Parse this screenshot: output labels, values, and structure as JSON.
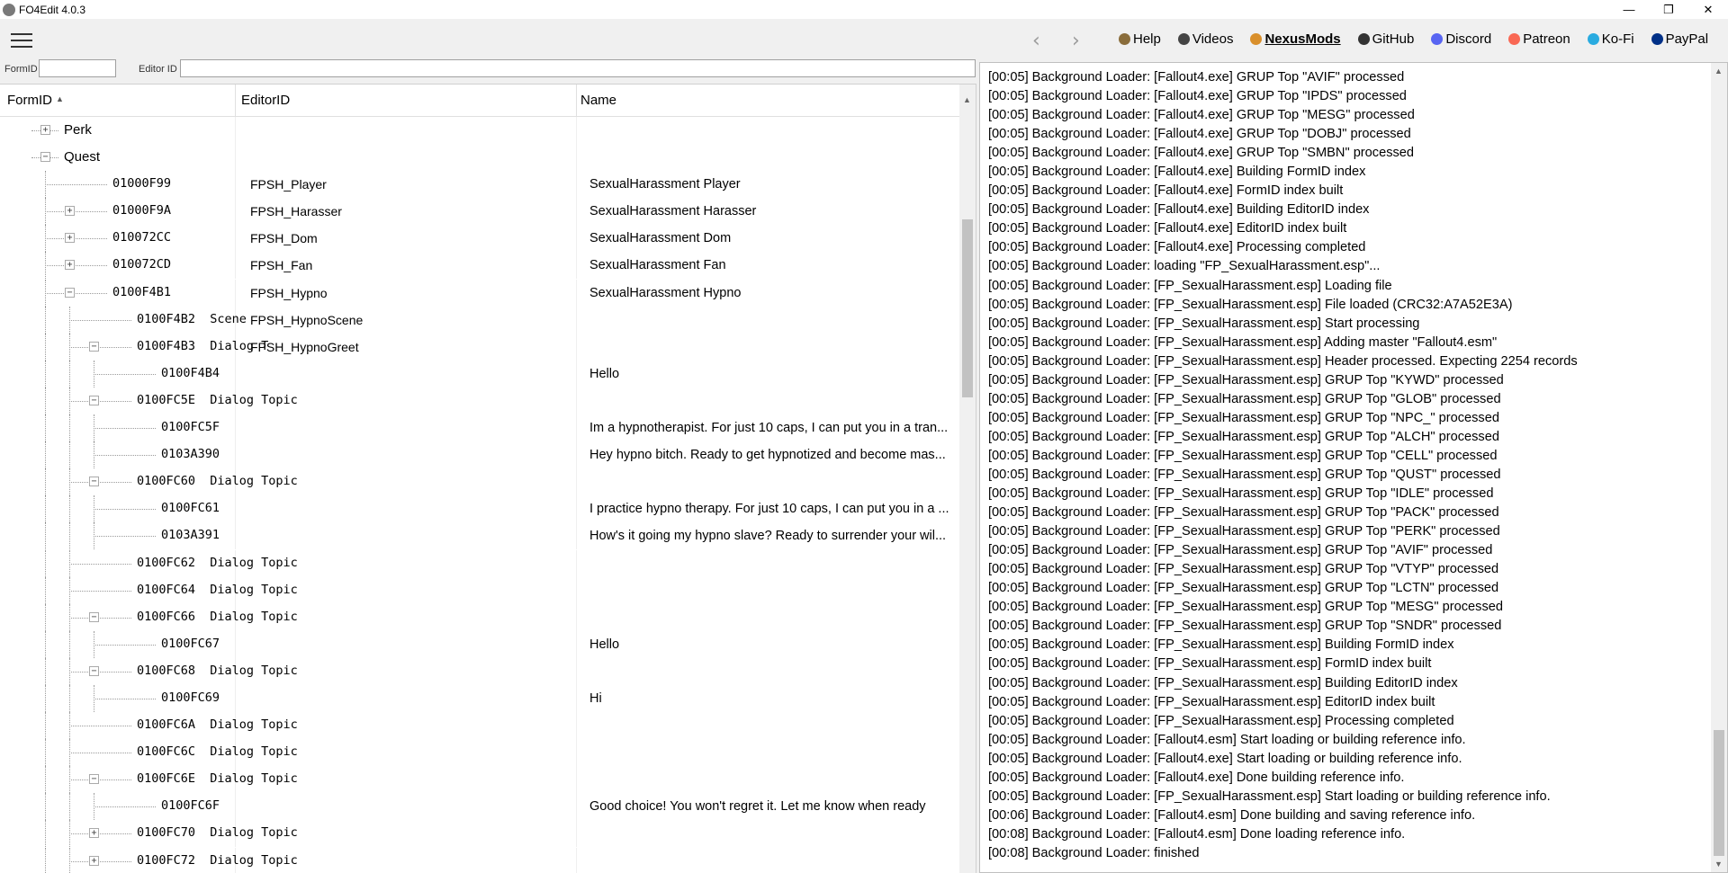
{
  "window": {
    "title": "FO4Edit 4.0.3",
    "controls": {
      "minimize": "—",
      "maximize": "❐",
      "close": "✕"
    }
  },
  "toolbar": {
    "back_icon": "chevron-left-icon",
    "forward_icon": "chevron-right-icon",
    "links": [
      {
        "label": "Help",
        "icon": "book-icon",
        "color": "#8a6d3b",
        "bold": false
      },
      {
        "label": "Videos",
        "icon": "video-icon",
        "color": "#444444",
        "bold": false
      },
      {
        "label": "NexusMods",
        "icon": "nexus-icon",
        "color": "#d98f2b",
        "bold": true
      },
      {
        "label": "GitHub",
        "icon": "github-icon",
        "color": "#333333",
        "bold": false
      },
      {
        "label": "Discord",
        "icon": "discord-icon",
        "color": "#5865f2",
        "bold": false
      },
      {
        "label": "Patreon",
        "icon": "patreon-icon",
        "color": "#f96854",
        "bold": false
      },
      {
        "label": "Ko-Fi",
        "icon": "kofi-icon",
        "color": "#29abe0",
        "bold": false
      },
      {
        "label": "PayPal",
        "icon": "paypal-icon",
        "color": "#003087",
        "bold": false
      }
    ]
  },
  "filter": {
    "formid_label": "FormID",
    "formid_value": "",
    "editorid_label": "Editor ID",
    "editorid_value": ""
  },
  "tree": {
    "columns": {
      "formid": "FormID",
      "editorid": "EditorID",
      "name": "Name"
    },
    "rows": [
      {
        "level": 1,
        "expander": "+",
        "text": "Perk",
        "is_group": true,
        "editorid": "",
        "name": ""
      },
      {
        "level": 1,
        "expander": "-",
        "text": "Quest",
        "is_group": true,
        "editorid": "",
        "name": ""
      },
      {
        "level": 2,
        "expander": "",
        "text": "01000F99",
        "editorid": "FPSH_Player",
        "name": "SexualHarassment Player"
      },
      {
        "level": 2,
        "expander": "+",
        "text": "01000F9A",
        "editorid": "FPSH_Harasser",
        "name": "SexualHarassment Harasser"
      },
      {
        "level": 2,
        "expander": "+",
        "text": "010072CC",
        "editorid": "FPSH_Dom",
        "name": "SexualHarassment Dom"
      },
      {
        "level": 2,
        "expander": "+",
        "text": "010072CD",
        "editorid": "FPSH_Fan",
        "name": "SexualHarassment Fan"
      },
      {
        "level": 2,
        "expander": "-",
        "text": "0100F4B1",
        "editorid": "FPSH_Hypno",
        "name": "SexualHarassment Hypno"
      },
      {
        "level": 3,
        "expander": "",
        "text": "0100F4B2  Scene",
        "editorid": "FPSH_HypnoScene",
        "name": ""
      },
      {
        "level": 3,
        "expander": "-",
        "text": "0100F4B3  Dialog T",
        "editorid": "FPSH_HypnoGreet",
        "name": ""
      },
      {
        "level": 4,
        "expander": "",
        "text": "0100F4B4",
        "editorid": "",
        "name": "Hello"
      },
      {
        "level": 3,
        "expander": "-",
        "text": "0100FC5E  Dialog Topic",
        "editorid": "",
        "name": ""
      },
      {
        "level": 4,
        "expander": "",
        "text": "0100FC5F",
        "editorid": "",
        "name": "Im a hypnotherapist. For just 10 caps, I can put you in a tran..."
      },
      {
        "level": 4,
        "expander": "",
        "text": "0103A390",
        "editorid": "",
        "name": "Hey hypno bitch. Ready to get hypnotized and become mas..."
      },
      {
        "level": 3,
        "expander": "-",
        "text": "0100FC60  Dialog Topic",
        "editorid": "",
        "name": ""
      },
      {
        "level": 4,
        "expander": "",
        "text": "0100FC61",
        "editorid": "",
        "name": "I practice hypno therapy. For just 10 caps, I can put you in a ..."
      },
      {
        "level": 4,
        "expander": "",
        "text": "0103A391",
        "editorid": "",
        "name": "How's it going my hypno slave? Ready to surrender your wil..."
      },
      {
        "level": 3,
        "expander": "",
        "text": "0100FC62  Dialog Topic",
        "editorid": "",
        "name": ""
      },
      {
        "level": 3,
        "expander": "",
        "text": "0100FC64  Dialog Topic",
        "editorid": "",
        "name": ""
      },
      {
        "level": 3,
        "expander": "-",
        "text": "0100FC66  Dialog Topic",
        "editorid": "",
        "name": ""
      },
      {
        "level": 4,
        "expander": "",
        "text": "0100FC67",
        "editorid": "",
        "name": "Hello"
      },
      {
        "level": 3,
        "expander": "-",
        "text": "0100FC68  Dialog Topic",
        "editorid": "",
        "name": ""
      },
      {
        "level": 4,
        "expander": "",
        "text": "0100FC69",
        "editorid": "",
        "name": "Hi"
      },
      {
        "level": 3,
        "expander": "",
        "text": "0100FC6A  Dialog Topic",
        "editorid": "",
        "name": ""
      },
      {
        "level": 3,
        "expander": "",
        "text": "0100FC6C  Dialog Topic",
        "editorid": "",
        "name": ""
      },
      {
        "level": 3,
        "expander": "-",
        "text": "0100FC6E  Dialog Topic",
        "editorid": "",
        "name": ""
      },
      {
        "level": 4,
        "expander": "",
        "text": "0100FC6F",
        "editorid": "",
        "name": "Good choice! You won't regret it. Let me know when ready"
      },
      {
        "level": 3,
        "expander": "+",
        "text": "0100FC70  Dialog Topic",
        "editorid": "",
        "name": ""
      },
      {
        "level": 3,
        "expander": "+",
        "text": "0100FC72  Dialog Topic",
        "editorid": "",
        "name": ""
      }
    ]
  },
  "log": {
    "lines": [
      "[00:05] Background Loader: [Fallout4.exe] GRUP Top \"AVIF\" processed",
      "[00:05] Background Loader: [Fallout4.exe] GRUP Top \"IPDS\" processed",
      "[00:05] Background Loader: [Fallout4.exe] GRUP Top \"MESG\" processed",
      "[00:05] Background Loader: [Fallout4.exe] GRUP Top \"DOBJ\" processed",
      "[00:05] Background Loader: [Fallout4.exe] GRUP Top \"SMBN\" processed",
      "[00:05] Background Loader: [Fallout4.exe] Building FormID index",
      "[00:05] Background Loader: [Fallout4.exe] FormID index built",
      "[00:05] Background Loader: [Fallout4.exe] Building EditorID index",
      "[00:05] Background Loader: [Fallout4.exe] EditorID index built",
      "[00:05] Background Loader: [Fallout4.exe] Processing completed",
      "[00:05] Background Loader: loading \"FP_SexualHarassment.esp\"...",
      "[00:05] Background Loader: [FP_SexualHarassment.esp] Loading file",
      "[00:05] Background Loader: [FP_SexualHarassment.esp] File loaded (CRC32:A7A52E3A)",
      "[00:05] Background Loader: [FP_SexualHarassment.esp] Start processing",
      "[00:05] Background Loader: [FP_SexualHarassment.esp] Adding master \"Fallout4.esm\"",
      "[00:05] Background Loader: [FP_SexualHarassment.esp] Header processed. Expecting 2254 records",
      "[00:05] Background Loader: [FP_SexualHarassment.esp] GRUP Top \"KYWD\" processed",
      "[00:05] Background Loader: [FP_SexualHarassment.esp] GRUP Top \"GLOB\" processed",
      "[00:05] Background Loader: [FP_SexualHarassment.esp] GRUP Top \"NPC_\" processed",
      "[00:05] Background Loader: [FP_SexualHarassment.esp] GRUP Top \"ALCH\" processed",
      "[00:05] Background Loader: [FP_SexualHarassment.esp] GRUP Top \"CELL\" processed",
      "[00:05] Background Loader: [FP_SexualHarassment.esp] GRUP Top \"QUST\" processed",
      "[00:05] Background Loader: [FP_SexualHarassment.esp] GRUP Top \"IDLE\" processed",
      "[00:05] Background Loader: [FP_SexualHarassment.esp] GRUP Top \"PACK\" processed",
      "[00:05] Background Loader: [FP_SexualHarassment.esp] GRUP Top \"PERK\" processed",
      "[00:05] Background Loader: [FP_SexualHarassment.esp] GRUP Top \"AVIF\" processed",
      "[00:05] Background Loader: [FP_SexualHarassment.esp] GRUP Top \"VTYP\" processed",
      "[00:05] Background Loader: [FP_SexualHarassment.esp] GRUP Top \"LCTN\" processed",
      "[00:05] Background Loader: [FP_SexualHarassment.esp] GRUP Top \"MESG\" processed",
      "[00:05] Background Loader: [FP_SexualHarassment.esp] GRUP Top \"SNDR\" processed",
      "[00:05] Background Loader: [FP_SexualHarassment.esp] Building FormID index",
      "[00:05] Background Loader: [FP_SexualHarassment.esp] FormID index built",
      "[00:05] Background Loader: [FP_SexualHarassment.esp] Building EditorID index",
      "[00:05] Background Loader: [FP_SexualHarassment.esp] EditorID index built",
      "[00:05] Background Loader: [FP_SexualHarassment.esp] Processing completed",
      "[00:05] Background Loader: [Fallout4.esm] Start loading or building reference info.",
      "[00:05] Background Loader: [Fallout4.exe] Start loading or building reference info.",
      "[00:05] Background Loader: [Fallout4.exe] Done building reference info.",
      "[00:05] Background Loader: [FP_SexualHarassment.esp] Start loading or building reference info.",
      "[00:06] Background Loader: [Fallout4.esm] Done building and saving reference info.",
      "[00:08] Background Loader: [Fallout4.esm] Done loading reference info.",
      "[00:08] Background Loader: finished"
    ]
  }
}
